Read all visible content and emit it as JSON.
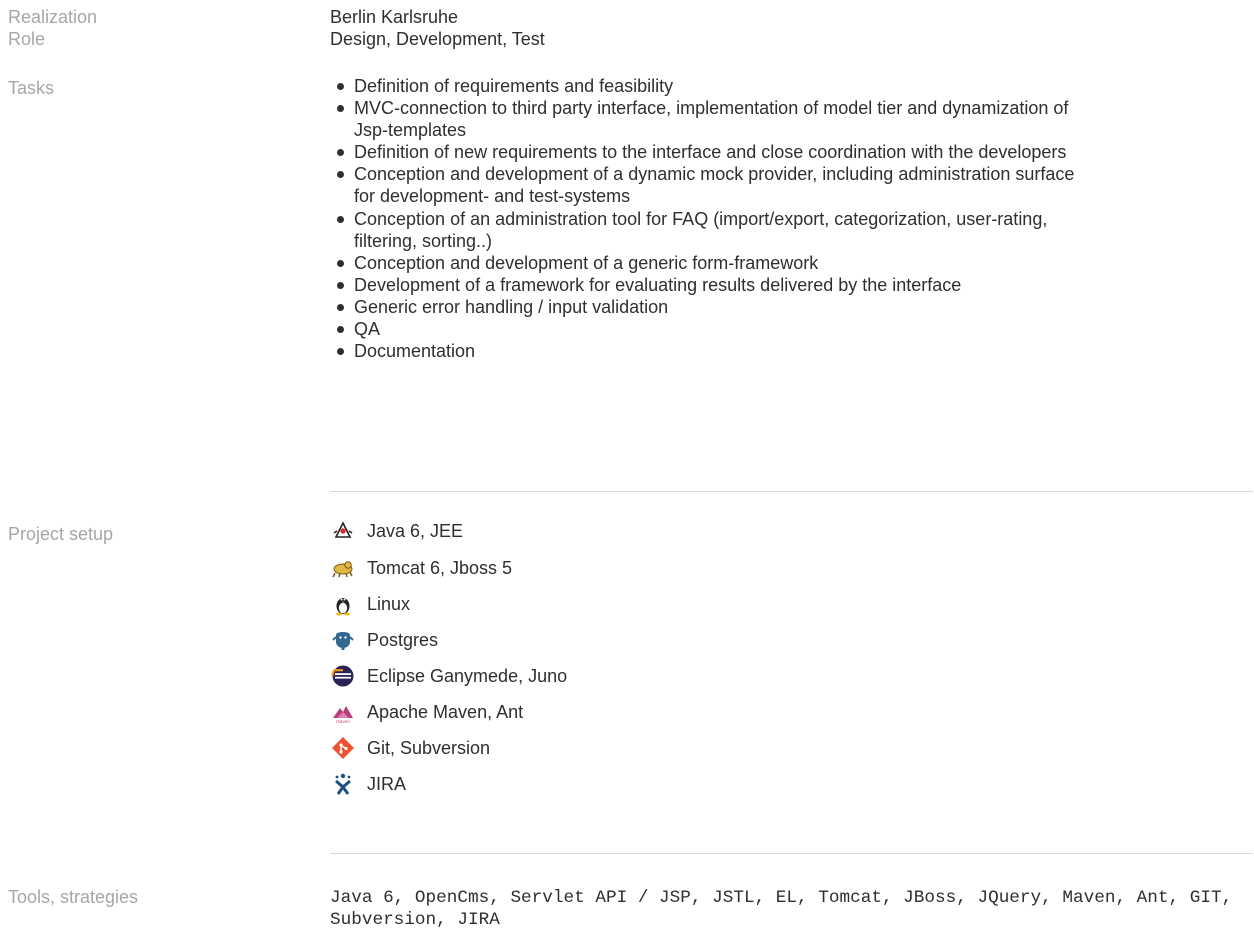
{
  "realization": {
    "label": "Realization",
    "value": "Berlin Karlsruhe"
  },
  "role": {
    "label": "Role",
    "value": "Design, Development, Test"
  },
  "tasks": {
    "label": "Tasks",
    "items": [
      "Definition of requirements and feasibility",
      "MVC-connection to third party interface, implementation of model tier and dynamization of Jsp-templates",
      "Definition of new requirements to the interface and close coordination with the developers",
      "Conception and development of a dynamic mock provider, including administration surface for development- and test-systems",
      "Conception of an administration tool for FAQ (import/export, categorization, user-rating, filtering, sorting..)",
      "Conception and development of a generic form-framework",
      "Development of a framework for evaluating results delivered by the interface",
      "Generic error handling / input validation",
      "QA",
      "Documentation"
    ]
  },
  "project_setup": {
    "label": "Project setup",
    "items": [
      {
        "icon": "java-icon",
        "text": "Java 6, JEE"
      },
      {
        "icon": "tomcat-icon",
        "text": "Tomcat 6, Jboss 5"
      },
      {
        "icon": "linux-icon",
        "text": "Linux"
      },
      {
        "icon": "postgres-icon",
        "text": "Postgres"
      },
      {
        "icon": "eclipse-icon",
        "text": "Eclipse Ganymede, Juno"
      },
      {
        "icon": "maven-icon",
        "text": "Apache Maven, Ant"
      },
      {
        "icon": "git-icon",
        "text": "Git, Subversion"
      },
      {
        "icon": "jira-icon",
        "text": "JIRA"
      }
    ]
  },
  "tools": {
    "label": "Tools, strategies",
    "value": "Java 6, OpenCms, Servlet API / JSP, JSTL, EL, Tomcat, JBoss, JQuery, Maven, Ant, GIT, Subversion, JIRA"
  },
  "colors": {
    "label": "#a6a6a6",
    "text": "#2f2f2f",
    "divider": "#d9d9d9"
  }
}
